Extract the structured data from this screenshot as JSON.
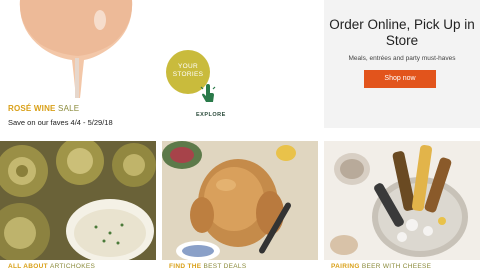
{
  "promo": {
    "sale_accent": "ROSÉ WINE",
    "sale_rest": "SALE",
    "dates": "Save on our faves 4/4 - 5/29/18",
    "image_icon": "rose-wine-glass-image"
  },
  "stories": {
    "title": "YOUR STORIES",
    "explore": "EXPLORE",
    "icon": "hand-pointer-icon"
  },
  "order": {
    "title": "Order Online, Pick Up in Store",
    "subtitle": "Meals, entrées and party must-haves",
    "button": "Shop now"
  },
  "tiles": [
    {
      "image": "artichokes-and-dip-image",
      "caption_accent": "ALL ABOUT",
      "caption_rest": "ARTICHOKES"
    },
    {
      "image": "roast-chicken-image",
      "caption_accent": "FIND THE",
      "caption_rest": "BEST DEALS"
    },
    {
      "image": "beverages-in-ice-bucket-image",
      "caption_accent": "PAIRING",
      "caption_rest": "BEER WITH CHEESE"
    }
  ],
  "colors": {
    "accent": "#d9a018",
    "button": "#e2541c",
    "badge": "#c9bb3c",
    "panel": "#f3f3f3"
  }
}
